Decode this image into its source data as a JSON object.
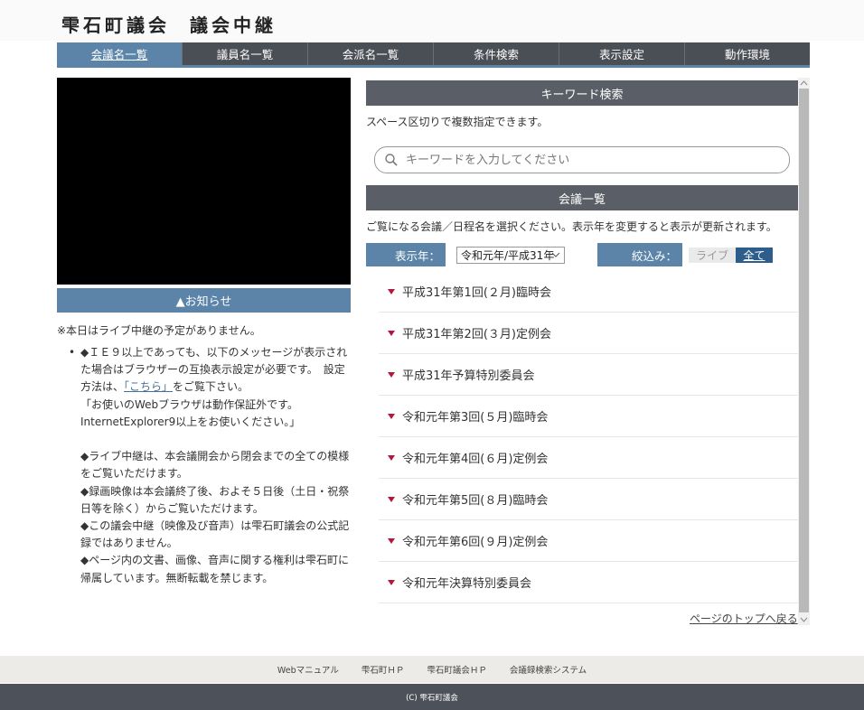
{
  "site": {
    "title_left": "雫石町議会",
    "title_right": "議会中継"
  },
  "nav": {
    "items": [
      {
        "label": "会議名一覧",
        "active": true
      },
      {
        "label": "議員名一覧",
        "active": false
      },
      {
        "label": "会派名一覧",
        "active": false
      },
      {
        "label": "条件検索",
        "active": false
      },
      {
        "label": "表示設定",
        "active": false
      },
      {
        "label": "動作環境",
        "active": false
      }
    ]
  },
  "notice": {
    "bar_label": "▲お知らせ",
    "live_status": "※本日はライブ中継の予定がありません。",
    "bullet": "•",
    "lines": [
      "◆ＩＥ９以上であっても、以下のメッセージが表示され",
      "た場合はブラウザーの互換表示設定が必要です。　設定",
      "方法は、",
      "「こちら」",
      "をご覧下さい。",
      "「お使いのWebブラウザは動作保証外です。",
      "InternetExplorer9以上をお使いください。」",
      "◆ライブ中継は、本会議開会から閉会までの全ての模様",
      "をご覧いただけます。",
      "◆録画映像は本会議終了後、およそ５日後（土日・祝祭",
      "日等を除く）からご覧いただけます。",
      "◆この議会中継（映像及び音声）は雫石町議会の公式記",
      "録ではありません。",
      "◆ページ内の文書、画像、音声に関する権利は雫石町に",
      "帰属しています。無断転載を禁じます。"
    ]
  },
  "keyword": {
    "heading": "キーワード検索",
    "note": "スペース区切りで複数指定できます。",
    "placeholder": "キーワードを入力してください"
  },
  "meetings": {
    "heading": "会議一覧",
    "note": "ご覧になる会議／日程名を選択ください。表示年を変更すると表示が更新されます。",
    "year_label": "表示年：",
    "year_value": "令和元年/平成31年",
    "narrow_label": "絞込み：",
    "toggle_live": "ライブ",
    "toggle_all": "全て",
    "items": [
      "平成31年第1回(２月)臨時会",
      "平成31年第2回(３月)定例会",
      "平成31年予算特別委員会",
      "令和元年第3回(５月)臨時会",
      "令和元年第4回(６月)定例会",
      "令和元年第5回(８月)臨時会",
      "令和元年第6回(９月)定例会",
      "令和元年決算特別委員会"
    ],
    "page_top": "ページのトップへ戻る"
  },
  "footer": {
    "links": [
      "Webマニュアル",
      "雫石町ＨＰ",
      "雫石町議会ＨＰ",
      "会議録検索システム"
    ],
    "copyright": "(C) 雫石町議会"
  },
  "colors": {
    "nav_bg": "#4a4e55",
    "accent": "#5b84a8",
    "section_head": "#5a5e66",
    "triangle": "#b0183c",
    "footer_bg": "#4d5159"
  }
}
